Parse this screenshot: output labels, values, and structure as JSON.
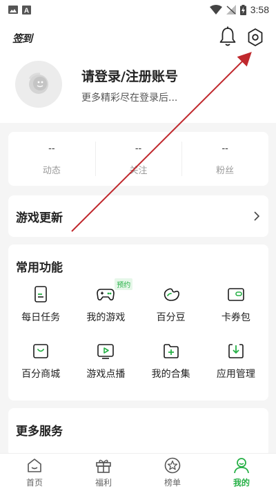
{
  "status_bar": {
    "time": "3:58"
  },
  "header": {
    "checkin_label": "签到"
  },
  "profile": {
    "title": "请登录/注册账号",
    "subtitle": "更多精彩尽在登录后..."
  },
  "stats": [
    {
      "value": "--",
      "label": "动态"
    },
    {
      "value": "--",
      "label": "关注"
    },
    {
      "value": "--",
      "label": "粉丝"
    }
  ],
  "game_updates": {
    "label": "游戏更新"
  },
  "functions": {
    "title": "常用功能",
    "items": [
      {
        "label": "每日任务",
        "icon": "daily-task-icon"
      },
      {
        "label": "我的游戏",
        "icon": "gamepad-icon",
        "badge": "预约"
      },
      {
        "label": "百分豆",
        "icon": "bean-icon"
      },
      {
        "label": "卡券包",
        "icon": "wallet-icon"
      },
      {
        "label": "百分商城",
        "icon": "mall-icon"
      },
      {
        "label": "游戏点播",
        "icon": "video-play-icon"
      },
      {
        "label": "我的合集",
        "icon": "collection-icon"
      },
      {
        "label": "应用管理",
        "icon": "download-manage-icon"
      }
    ]
  },
  "more_services": {
    "title": "更多服务"
  },
  "tabbar": {
    "items": [
      {
        "label": "首页",
        "icon": "home-icon"
      },
      {
        "label": "福利",
        "icon": "gift-icon"
      },
      {
        "label": "榜单",
        "icon": "ranking-icon"
      },
      {
        "label": "我的",
        "icon": "profile-icon",
        "active": true
      }
    ]
  },
  "colors": {
    "accent": "#26b046",
    "annotation_arrow": "#c0282d"
  }
}
